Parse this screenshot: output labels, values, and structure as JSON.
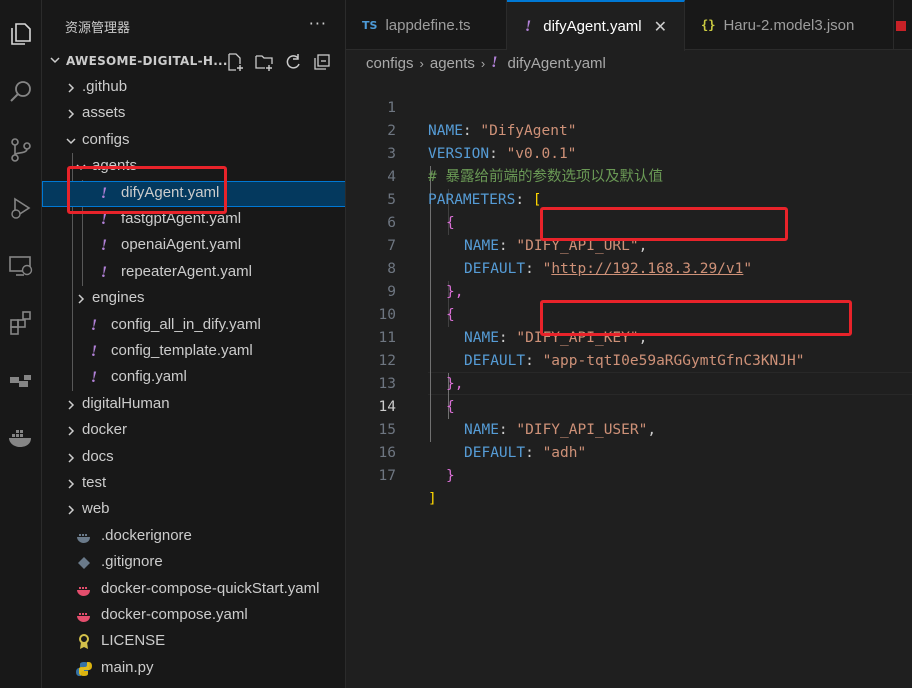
{
  "sidebar": {
    "title": "资源管理器",
    "more_label": "···",
    "section_label": "AWESOME-DIGITAL-H...",
    "tree": [
      {
        "label": ".github",
        "type": "folder",
        "expanded": false
      },
      {
        "label": "assets",
        "type": "folder",
        "expanded": false
      },
      {
        "label": "configs",
        "type": "folder",
        "expanded": true
      },
      {
        "label": "agents",
        "type": "folder",
        "expanded": true
      },
      {
        "label": "difyAgent.yaml",
        "type": "yaml",
        "selected": true
      },
      {
        "label": "fastgptAgent.yaml",
        "type": "yaml"
      },
      {
        "label": "openaiAgent.yaml",
        "type": "yaml"
      },
      {
        "label": "repeaterAgent.yaml",
        "type": "yaml"
      },
      {
        "label": "engines",
        "type": "folder",
        "expanded": false
      },
      {
        "label": "config_all_in_dify.yaml",
        "type": "yaml"
      },
      {
        "label": "config_template.yaml",
        "type": "yaml"
      },
      {
        "label": "config.yaml",
        "type": "yaml"
      },
      {
        "label": "digitalHuman",
        "type": "folder",
        "expanded": false
      },
      {
        "label": "docker",
        "type": "folder",
        "expanded": false
      },
      {
        "label": "docs",
        "type": "folder",
        "expanded": false
      },
      {
        "label": "test",
        "type": "folder",
        "expanded": false
      },
      {
        "label": "web",
        "type": "folder",
        "expanded": false
      },
      {
        "label": ".dockerignore",
        "type": "docker-icon"
      },
      {
        "label": ".gitignore",
        "type": "git-icon"
      },
      {
        "label": "docker-compose-quickStart.yaml",
        "type": "compose-icon"
      },
      {
        "label": "docker-compose.yaml",
        "type": "compose-icon"
      },
      {
        "label": "LICENSE",
        "type": "license-icon"
      },
      {
        "label": "main.py",
        "type": "python-icon"
      }
    ]
  },
  "tabs": [
    {
      "label": "lappdefine.ts",
      "badge": "TS"
    },
    {
      "label": "difyAgent.yaml",
      "badge": "!",
      "active": true
    },
    {
      "label": "Haru-2.model3.json",
      "badge": "{}"
    }
  ],
  "breadcrumb": [
    "configs",
    "agents",
    "difyAgent.yaml"
  ],
  "editor": {
    "current_line": 14,
    "lines": [
      {
        "n": "1",
        "text": "NAME: \"DifyAgent\""
      },
      {
        "n": "2",
        "text": "VERSION: \"v0.0.1\""
      },
      {
        "n": "3",
        "text": "# 暴露给前端的参数选项以及默认值"
      },
      {
        "n": "4",
        "text": "PARAMETERS: ["
      },
      {
        "n": "5",
        "text": "  {"
      },
      {
        "n": "6",
        "text": "    NAME: \"DIFY_API_URL\","
      },
      {
        "n": "7",
        "text": "    DEFAULT: \"http://192.168.3.29/v1\""
      },
      {
        "n": "8",
        "text": "  },"
      },
      {
        "n": "9",
        "text": "  {"
      },
      {
        "n": "10",
        "text": "    NAME: \"DIFY_API_KEY\","
      },
      {
        "n": "11",
        "text": "    DEFAULT: \"app-tqtI0e59aRGGymtGfnC3KNJH\""
      },
      {
        "n": "12",
        "text": "  },"
      },
      {
        "n": "13",
        "text": "  {"
      },
      {
        "n": "14",
        "text": "    NAME: \"DIFY_API_USER\","
      },
      {
        "n": "15",
        "text": "    DEFAULT: \"adh\""
      },
      {
        "n": "16",
        "text": "  }"
      },
      {
        "n": "17",
        "text": "]"
      }
    ],
    "tokens": {
      "l1_key": "NAME",
      "l1_val": "\"DifyAgent\"",
      "l2_key": "VERSION",
      "l2_val": "\"v0.0.1\"",
      "l3_comment": "# 暴露给前端的参数选项以及默认值",
      "l4_key": "PARAMETERS",
      "l4_open": "[",
      "brace_open": "{",
      "brace_close": "}",
      "brace_close_comma": "},",
      "name_key": "NAME",
      "default_key": "DEFAULT",
      "l6_val": "\"DIFY_API_URL\"",
      "l7_q": "\"",
      "l7_url": "http://192.168.3.29/v1",
      "l10_val": "\"DIFY_API_KEY\"",
      "l11_val": "\"app-tqtI0e59aRGGymtGfnC3KNJH\"",
      "l14_val": "\"DIFY_API_USER\"",
      "l15_val": "\"adh\"",
      "l17_close": "]",
      "colon": ": ",
      "comma": ","
    }
  },
  "colors": {
    "key": "#569cd6",
    "string": "#ce9178",
    "comment": "#6a9955",
    "yaml_icon": "#b180d7",
    "highlight_box": "#e8232a",
    "selection": "#04395e"
  }
}
